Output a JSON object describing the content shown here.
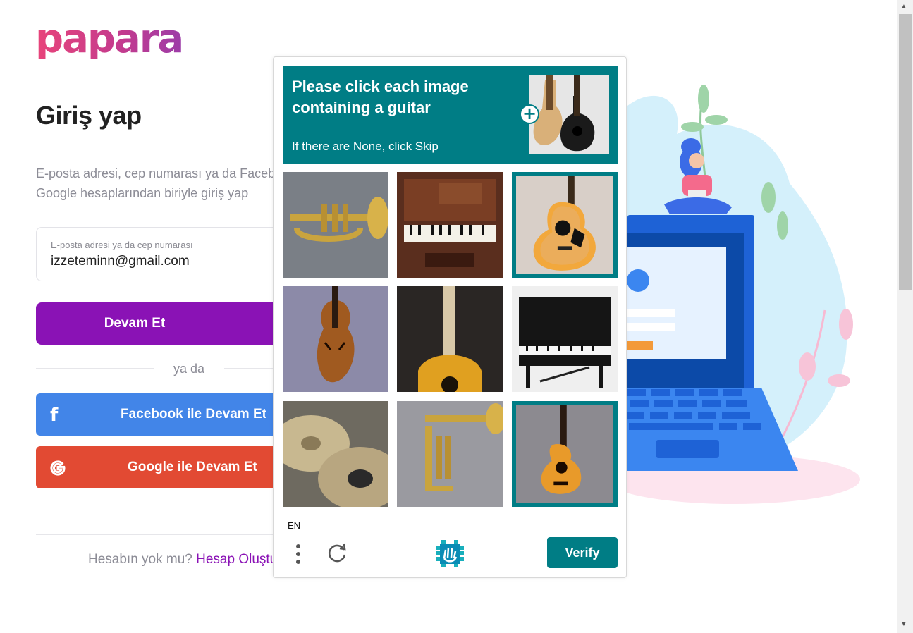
{
  "brand": {
    "logo_text": "papara"
  },
  "login": {
    "title": "Giriş yap",
    "subtitle_line1": "E-posta adresi, cep numarası ya da Facebook,",
    "subtitle_line2": "Google hesaplarından biriyle giriş yap",
    "email_label": "E-posta adresi ya da cep numarası",
    "email_value": "izzeteminn@gmail.com",
    "continue_label": "Devam Et",
    "or_text": "ya da",
    "facebook_label": "Facebook ile Devam Et",
    "google_label": "Google ile Devam Et",
    "no_account_text": "Hesabın yok mu?",
    "create_account_link": "Hesap Oluştur"
  },
  "captcha": {
    "prompt_title": "Please click each image containing a guitar",
    "prompt_hint": "If there are None, click Skip",
    "language": "EN",
    "verify_label": "Verify",
    "tiles": [
      {
        "subject": "trumpet",
        "selected": false
      },
      {
        "subject": "piano",
        "selected": false
      },
      {
        "subject": "guitar",
        "selected": true
      },
      {
        "subject": "violin",
        "selected": false
      },
      {
        "subject": "guitar",
        "selected": false
      },
      {
        "subject": "piano",
        "selected": false
      },
      {
        "subject": "cymbals",
        "selected": false
      },
      {
        "subject": "trumpet",
        "selected": false
      },
      {
        "subject": "guitar",
        "selected": true
      }
    ]
  },
  "colors": {
    "primary_purple": "#8a12b5",
    "facebook_blue": "#4285e8",
    "google_red": "#e24a33",
    "captcha_teal": "#007d85"
  }
}
